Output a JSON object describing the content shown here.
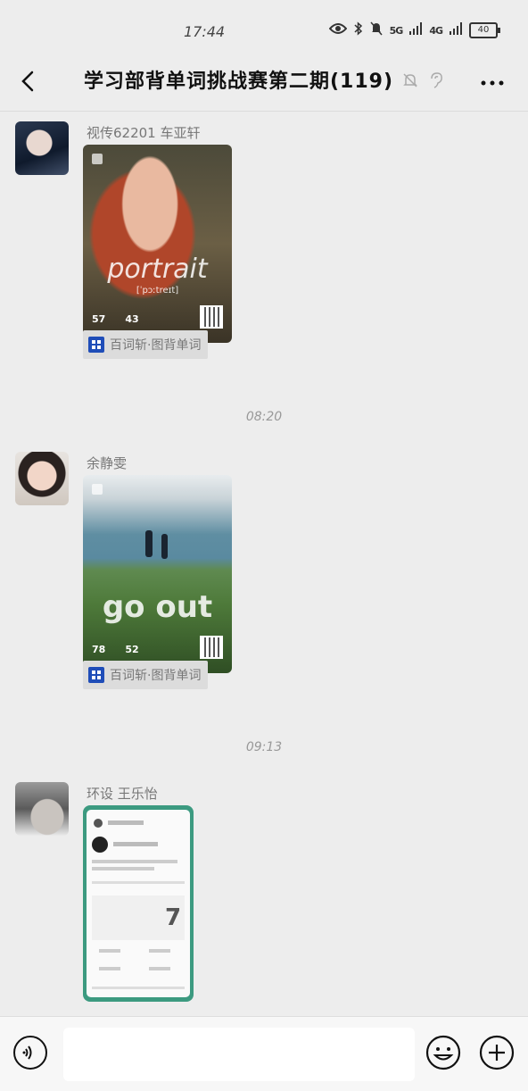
{
  "status": {
    "time": "17:44",
    "sig1": "5G",
    "sig2": "4G",
    "battery": "40"
  },
  "header": {
    "title": "学习部背单词挑战赛第二期(119)"
  },
  "messages": [
    {
      "sender": "视传62201 车亚轩",
      "card_word": "portrait",
      "card_sub": "[ˈpɔːtreɪt]",
      "stats": [
        "57",
        "43"
      ],
      "source": "百词斩·图背单词"
    },
    {
      "sender": "余静雯",
      "card_word": "go out",
      "stats": [
        "78",
        "52"
      ],
      "source": "百词斩·图背单词"
    },
    {
      "sender": "环设 王乐怡",
      "card_number": "7"
    }
  ],
  "time_separators": [
    "08:20",
    "09:13"
  ],
  "composer": {
    "placeholder": ""
  }
}
